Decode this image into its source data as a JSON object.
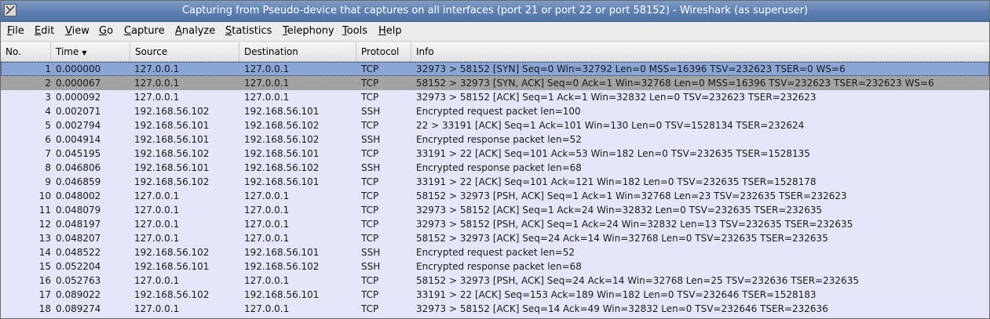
{
  "window": {
    "title": "Capturing from Pseudo-device that captures on all interfaces (port 21 or port 22 or port 58152) - Wireshark (as superuser)"
  },
  "menu": [
    "File",
    "Edit",
    "View",
    "Go",
    "Capture",
    "Analyze",
    "Statistics",
    "Telephony",
    "Tools",
    "Help"
  ],
  "columns": {
    "no": "No.",
    "time": "Time",
    "source": "Source",
    "destination": "Destination",
    "protocol": "Protocol",
    "info": "Info"
  },
  "colors": {
    "row_background": "#e6e6fa",
    "selected_row": "#8aa6d6",
    "marked_row": "#a3a3a3",
    "titlebar": "#5d7fb0"
  },
  "packets": [
    {
      "no": "1",
      "time": "0.000000",
      "source": "127.0.0.1",
      "destination": "127.0.0.1",
      "protocol": "TCP",
      "info": "32973 > 58152 [SYN] Seq=0 Win=32792 Len=0 MSS=16396 TSV=232623 TSER=0 WS=6"
    },
    {
      "no": "2",
      "time": "0.000067",
      "source": "127.0.0.1",
      "destination": "127.0.0.1",
      "protocol": "TCP",
      "info": "58152 > 32973 [SYN, ACK] Seq=0 Ack=1 Win=32768 Len=0 MSS=16396 TSV=232623 TSER=232623 WS=6"
    },
    {
      "no": "3",
      "time": "0.000092",
      "source": "127.0.0.1",
      "destination": "127.0.0.1",
      "protocol": "TCP",
      "info": "32973 > 58152 [ACK] Seq=1 Ack=1 Win=32832 Len=0 TSV=232623 TSER=232623"
    },
    {
      "no": "4",
      "time": "0.002071",
      "source": "192.168.56.102",
      "destination": "192.168.56.101",
      "protocol": "SSH",
      "info": "Encrypted request packet len=100"
    },
    {
      "no": "5",
      "time": "0.002794",
      "source": "192.168.56.101",
      "destination": "192.168.56.102",
      "protocol": "TCP",
      "info": "22 > 33191 [ACK] Seq=1 Ack=101 Win=130 Len=0 TSV=1528134 TSER=232624"
    },
    {
      "no": "6",
      "time": "0.004914",
      "source": "192.168.56.101",
      "destination": "192.168.56.102",
      "protocol": "SSH",
      "info": "Encrypted response packet len=52"
    },
    {
      "no": "7",
      "time": "0.045195",
      "source": "192.168.56.102",
      "destination": "192.168.56.101",
      "protocol": "TCP",
      "info": "33191 > 22 [ACK] Seq=101 Ack=53 Win=182 Len=0 TSV=232635 TSER=1528135"
    },
    {
      "no": "8",
      "time": "0.046806",
      "source": "192.168.56.101",
      "destination": "192.168.56.102",
      "protocol": "SSH",
      "info": "Encrypted response packet len=68"
    },
    {
      "no": "9",
      "time": "0.046859",
      "source": "192.168.56.102",
      "destination": "192.168.56.101",
      "protocol": "TCP",
      "info": "33191 > 22 [ACK] Seq=101 Ack=121 Win=182 Len=0 TSV=232635 TSER=1528178"
    },
    {
      "no": "10",
      "time": "0.048002",
      "source": "127.0.0.1",
      "destination": "127.0.0.1",
      "protocol": "TCP",
      "info": "58152 > 32973 [PSH, ACK] Seq=1 Ack=1 Win=32768 Len=23 TSV=232635 TSER=232623"
    },
    {
      "no": "11",
      "time": "0.048079",
      "source": "127.0.0.1",
      "destination": "127.0.0.1",
      "protocol": "TCP",
      "info": "32973 > 58152 [ACK] Seq=1 Ack=24 Win=32832 Len=0 TSV=232635 TSER=232635"
    },
    {
      "no": "12",
      "time": "0.048197",
      "source": "127.0.0.1",
      "destination": "127.0.0.1",
      "protocol": "TCP",
      "info": "32973 > 58152 [PSH, ACK] Seq=1 Ack=24 Win=32832 Len=13 TSV=232635 TSER=232635"
    },
    {
      "no": "13",
      "time": "0.048207",
      "source": "127.0.0.1",
      "destination": "127.0.0.1",
      "protocol": "TCP",
      "info": "58152 > 32973 [ACK] Seq=24 Ack=14 Win=32768 Len=0 TSV=232635 TSER=232635"
    },
    {
      "no": "14",
      "time": "0.048522",
      "source": "192.168.56.102",
      "destination": "192.168.56.101",
      "protocol": "SSH",
      "info": "Encrypted request packet len=52"
    },
    {
      "no": "15",
      "time": "0.052204",
      "source": "192.168.56.101",
      "destination": "192.168.56.102",
      "protocol": "SSH",
      "info": "Encrypted response packet len=68"
    },
    {
      "no": "16",
      "time": "0.052763",
      "source": "127.0.0.1",
      "destination": "127.0.0.1",
      "protocol": "TCP",
      "info": "58152 > 32973 [PSH, ACK] Seq=24 Ack=14 Win=32768 Len=25 TSV=232636 TSER=232635"
    },
    {
      "no": "17",
      "time": "0.089022",
      "source": "192.168.56.102",
      "destination": "192.168.56.101",
      "protocol": "TCP",
      "info": "33191 > 22 [ACK] Seq=153 Ack=189 Win=182 Len=0 TSV=232646 TSER=1528183"
    },
    {
      "no": "18",
      "time": "0.089274",
      "source": "127.0.0.1",
      "destination": "127.0.0.1",
      "protocol": "TCP",
      "info": "32973 > 58152 [ACK] Seq=14 Ack=49 Win=32832 Len=0 TSV=232646 TSER=232636"
    }
  ]
}
